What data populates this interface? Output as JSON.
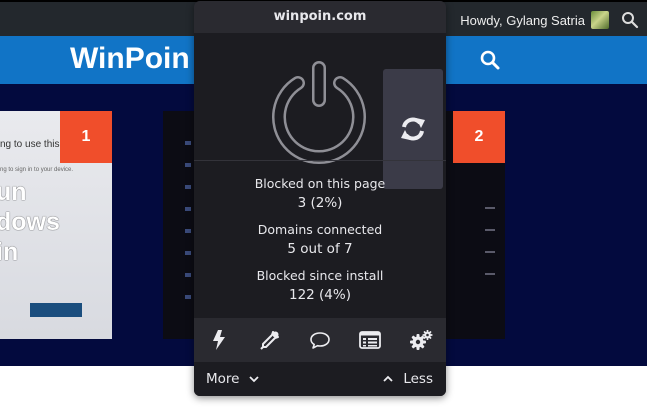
{
  "adminbar": {
    "greeting": "Howdy, Gylang Satria"
  },
  "site": {
    "logo": "WinPoin"
  },
  "articles": [
    {
      "badge": "1",
      "small_text": "ng to use this",
      "tiny_text": "ng to sign in to your device.",
      "big_text": "un\ndows\nin"
    },
    {
      "badge": "2"
    }
  ],
  "popup": {
    "hostname": "winpoin.com",
    "stats": [
      {
        "label": "Blocked on this page",
        "value": "3 (2%)"
      },
      {
        "label": "Domains connected",
        "value": "5 out of 7"
      },
      {
        "label": "Blocked since install",
        "value": "122 (4%)"
      }
    ],
    "tools": [
      "bolt-icon",
      "eyedropper-icon",
      "speech-bubble-icon",
      "list-icon",
      "gears-icon"
    ],
    "footer": {
      "more": "More",
      "less": "Less"
    }
  }
}
